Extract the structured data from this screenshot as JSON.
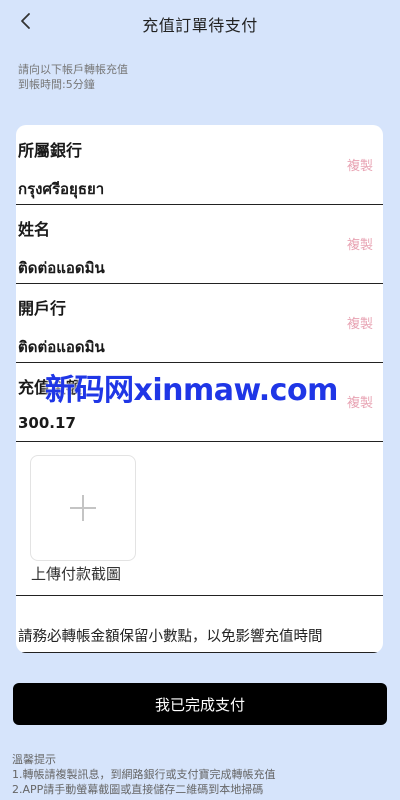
{
  "header": {
    "title": "充值訂單待支付"
  },
  "notice": {
    "line1": "請向以下帳戶轉帳充值",
    "line2": "到帳時間:5分鐘"
  },
  "fields": [
    {
      "label": "所屬銀行",
      "value": "กรุงศรีอยุธยา",
      "copy": "複製"
    },
    {
      "label": "姓名",
      "value": "ติดต่อแอดมิน",
      "copy": "複製"
    },
    {
      "label": "開戶行",
      "value": "ติดต่อแอดมิน",
      "copy": "複製"
    },
    {
      "label": "充值金額",
      "value": "300.17",
      "copy": "複製"
    }
  ],
  "upload": {
    "label": "上傳付款截圖"
  },
  "warning": "請務必轉帳金額保留小數點，以免影響充值時間",
  "watermark": "新码网xinmaw.com",
  "submit_label": "我已完成支付",
  "tips": {
    "title": "溫馨提示",
    "line1": "1.轉帳請複製訊息，到網路銀行或支付寶完成轉帳充值",
    "line2": "2.APP請手動螢幕截圖或直接儲存二維碼到本地掃碼"
  },
  "colors": {
    "background": "#d6e4fb",
    "copy": "#e8a3b3",
    "button": "#000000",
    "watermark": "#1f36e6"
  }
}
